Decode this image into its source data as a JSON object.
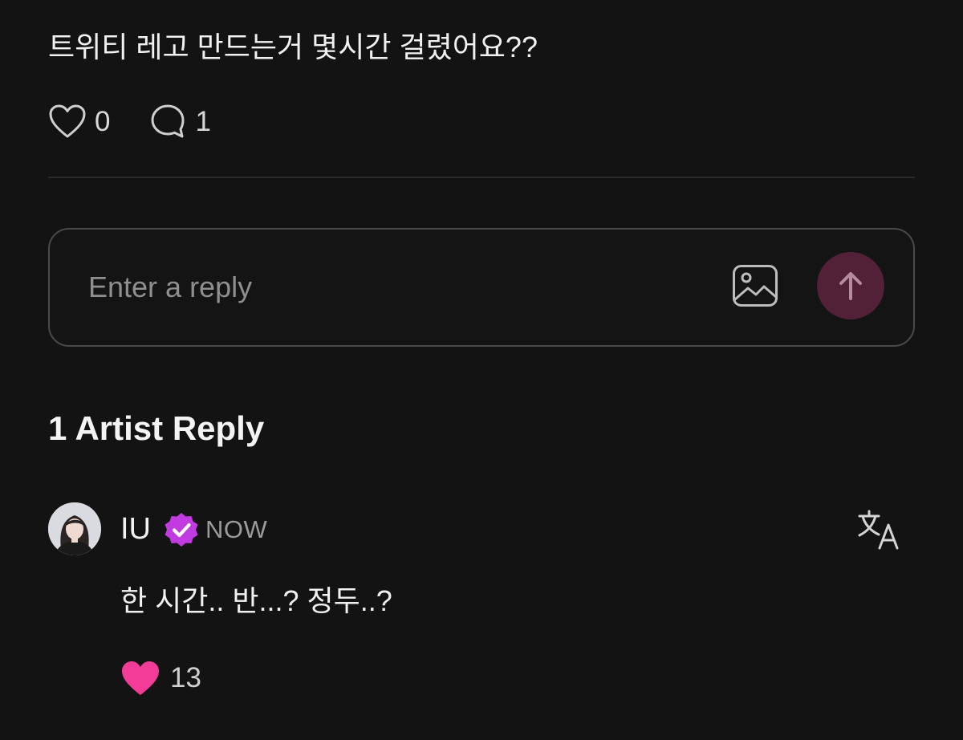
{
  "post": {
    "text": "트위티 레고 만드는거 몇시간 걸렸어요??",
    "like_count": "0",
    "comment_count": "1"
  },
  "reply_box": {
    "placeholder": "Enter a reply",
    "image_icon": "image-icon",
    "send_icon": "arrow-up-icon"
  },
  "replies_section": {
    "title": "1 Artist Reply"
  },
  "comment": {
    "author": "IU",
    "time": "NOW",
    "text": "한 시간.. 반...? 정두..?",
    "like_count": "13",
    "translate_icon": "translate-icon"
  },
  "colors": {
    "background": "#131313",
    "verified_badge": "#c13be0",
    "send_button": "#532137",
    "liked_heart": "#f23c97"
  }
}
